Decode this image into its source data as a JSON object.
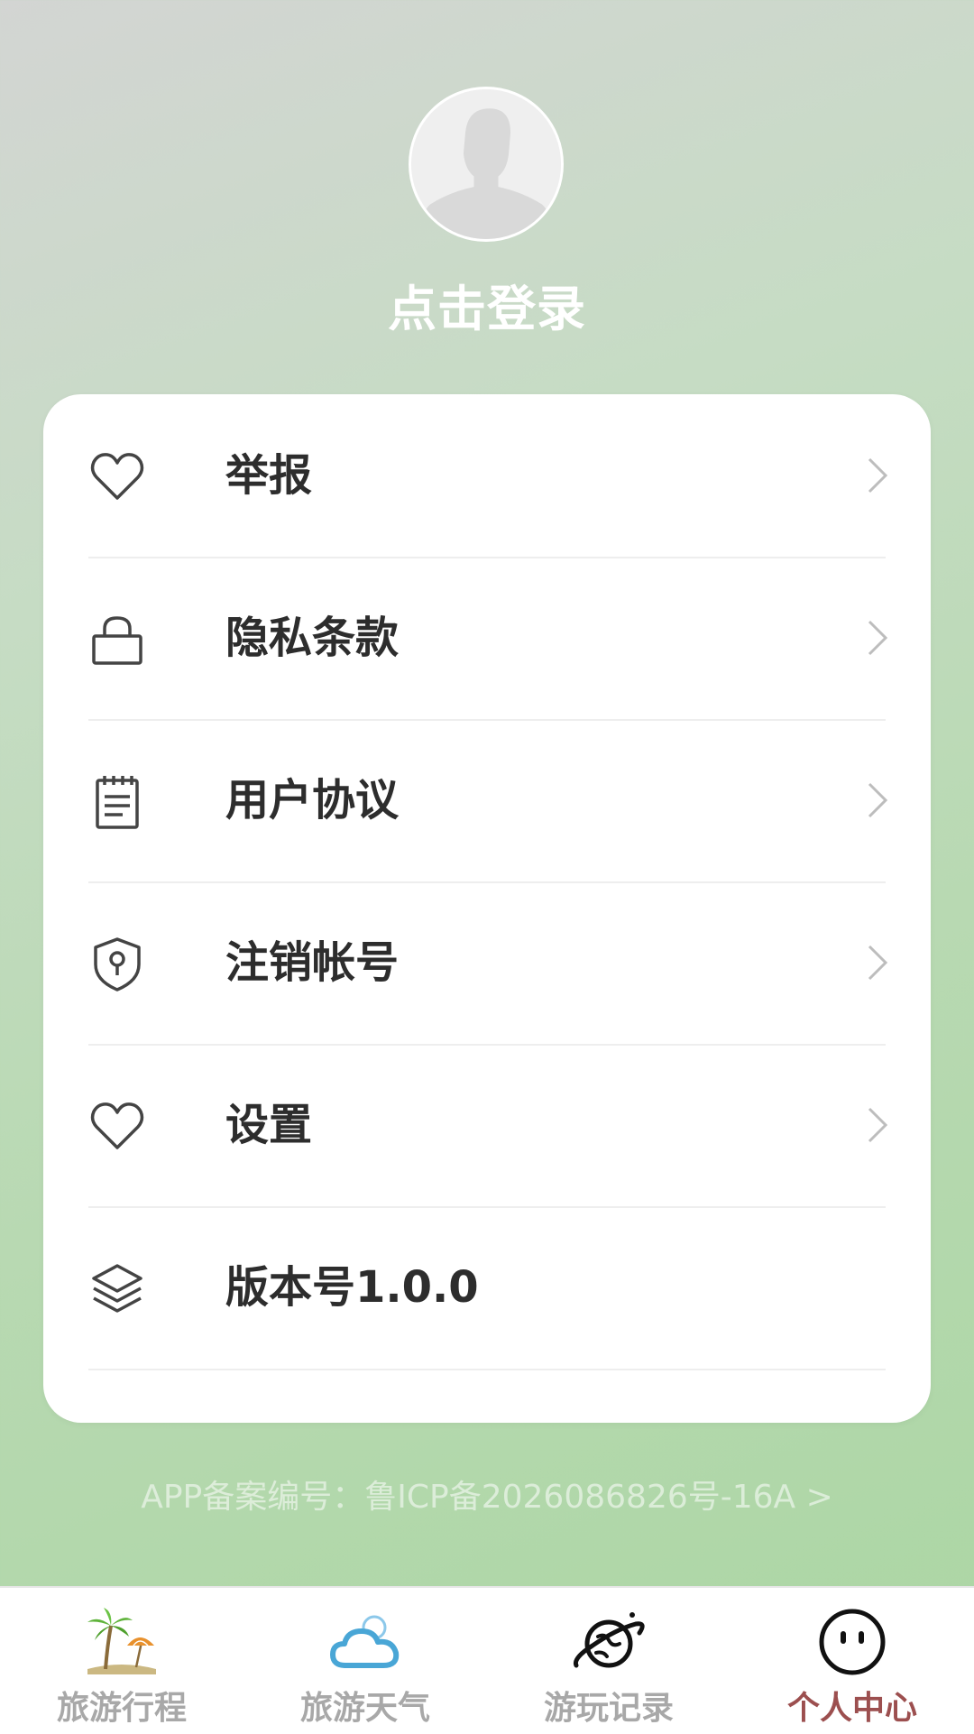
{
  "profile": {
    "login_text": "点击登录"
  },
  "menu": [
    {
      "label": "举报",
      "icon": "heart-icon",
      "has_chevron": true
    },
    {
      "label": "隐私条款",
      "icon": "lock-icon",
      "has_chevron": true
    },
    {
      "label": "用户协议",
      "icon": "notepad-icon",
      "has_chevron": true
    },
    {
      "label": "注销帐号",
      "icon": "shield-key-icon",
      "has_chevron": true
    },
    {
      "label": "设置",
      "icon": "heart-icon",
      "has_chevron": true
    },
    {
      "label": "版本号1.0.0",
      "icon": "layers-icon",
      "has_chevron": false
    }
  ],
  "footer": {
    "icp_text": "APP备案编号：鲁ICP备2026086826号-16A  >"
  },
  "tabbar": [
    {
      "label": "旅游行程",
      "icon": "palm-tree-icon",
      "active": false
    },
    {
      "label": "旅游天气",
      "icon": "cloud-sun-icon",
      "active": false
    },
    {
      "label": "游玩记录",
      "icon": "planet-icon",
      "active": false
    },
    {
      "label": "个人中心",
      "icon": "smiley-face-icon",
      "active": true
    }
  ],
  "colors": {
    "active_tab": "#9c4f4f",
    "inactive_tab": "#a8a8a8",
    "menu_text": "#2d2d2d",
    "bg_gradient_start": "#d3d5d3",
    "bg_gradient_end": "#abd6a3"
  }
}
